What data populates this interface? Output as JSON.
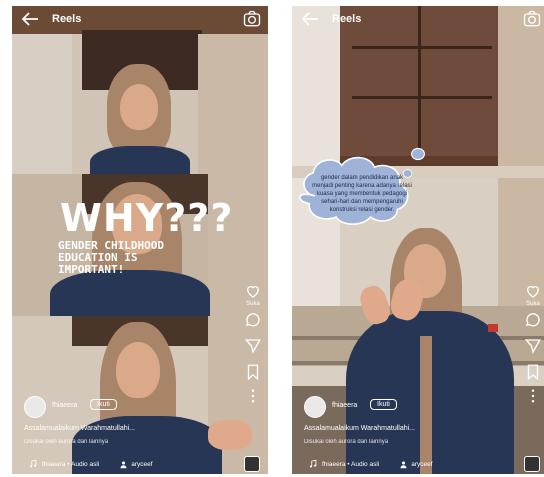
{
  "left": {
    "title": "Reels",
    "why_text": "WHY???",
    "topic_text": "GENDER CHILDHOOD EDUCATION IS IMPORTANT!",
    "user": "fhiaeera",
    "follow": "Ikuti",
    "caption": "Assalamualaikum Warahmatullahi...",
    "sub_caption": "Disukai oleh aurora dan lainnya",
    "audio": "fhiaeera • Audio asli",
    "tagged": "aryceef",
    "side_label": "Suka"
  },
  "right": {
    "title": "Reels",
    "bubble_text": "gender dalam pendidikan anak menjadi penting karena adanya relasi kuasa yang membentuk pedagogi sehari-hari dan mempengaruhi konstruksi relasi gender.",
    "user": "fhiaeera",
    "follow": "Ikuti",
    "caption": "Assalamualaikum Warahmatullahi...",
    "sub_caption": "Disukai oleh aurora dan lainnya",
    "audio": "fhiaeera • Audio asli",
    "tagged": "aryceef",
    "side_label": "Suka"
  },
  "icons": [
    "back-arrow-icon",
    "camera-icon",
    "heart-icon",
    "comment-icon",
    "send-icon",
    "bookmark-icon",
    "more-icon",
    "music-icon",
    "person-icon"
  ],
  "colors": {
    "jacket": "#273654",
    "hijab": "#a88468",
    "cloud": "#9fb3d8"
  }
}
